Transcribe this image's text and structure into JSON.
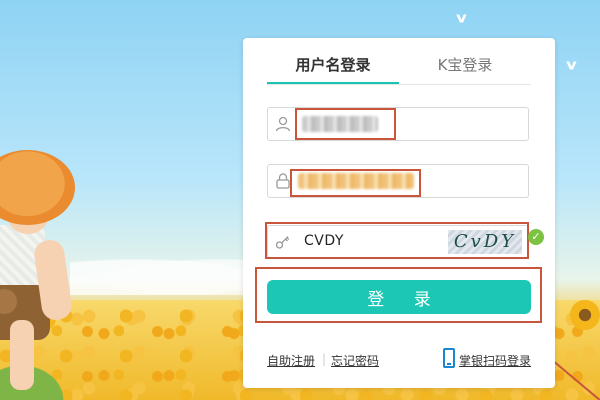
{
  "tabs": {
    "username_login": "用户名登录",
    "kbao_login": "K宝登录"
  },
  "captcha": {
    "input_value": "CVDY",
    "image_text": "CvDY"
  },
  "login_button": "登 录",
  "footer": {
    "register": "自助注册",
    "separator": "|",
    "forgot_password": "忘记密码",
    "scan_login": "掌银扫码登录"
  },
  "colors": {
    "accent": "#1cc7b6",
    "annotation": "#c9563a",
    "link": "#1a86d0"
  },
  "icons": [
    "user-icon",
    "lock-icon",
    "key-icon",
    "check-icon",
    "phone-icon"
  ]
}
